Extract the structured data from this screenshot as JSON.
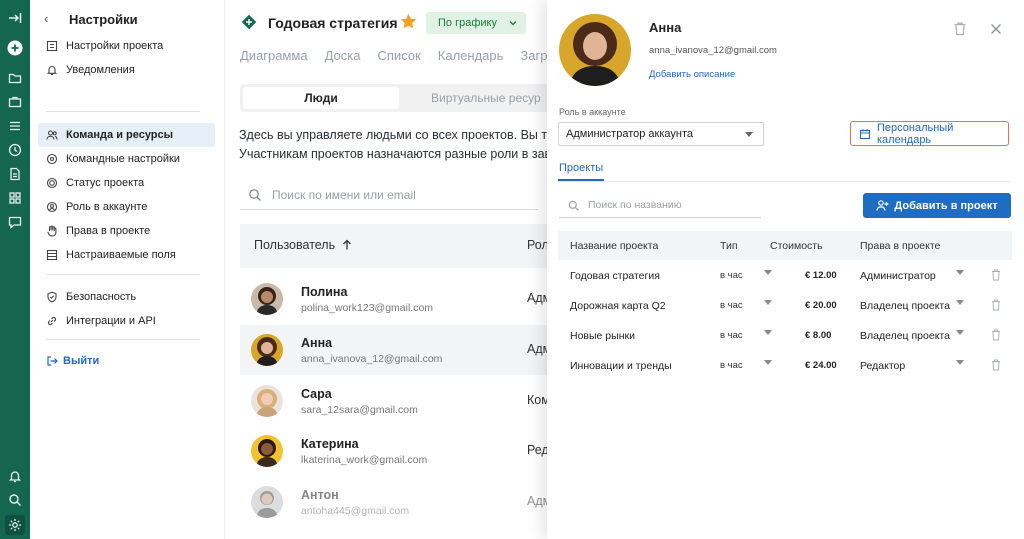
{
  "settings": {
    "title": "Настройки",
    "items": [
      {
        "label": "Настройки проекта",
        "icon": "project-settings-icon"
      },
      {
        "label": "Уведомления",
        "icon": "bell-icon"
      },
      {
        "label": "Команда и ресурсы",
        "icon": "team-icon",
        "active": true
      },
      {
        "label": "Командные настройки",
        "icon": "team-settings-icon"
      },
      {
        "label": "Статус проекта",
        "icon": "status-icon"
      },
      {
        "label": "Роль в аккаунте",
        "icon": "role-icon"
      },
      {
        "label": "Права в проекте",
        "icon": "hand-icon"
      },
      {
        "label": "Настраиваемые поля",
        "icon": "fields-icon"
      },
      {
        "label": "Безопасность",
        "icon": "shield-icon"
      },
      {
        "label": "Интеграции и API",
        "icon": "integrations-icon"
      }
    ],
    "logout": "Выйти"
  },
  "project": {
    "title": "Годовая стратегия",
    "status": "По графику",
    "views": [
      "Диаграмма",
      "Доска",
      "Список",
      "Календарь",
      "Загр"
    ],
    "segments": [
      "Люди",
      "Виртуальные ресур"
    ],
    "description_line1": "Здесь вы управляете людьми со всех проектов. Вы та",
    "description_line2": "Участникам проектов назначаются разные роли в зав",
    "search_placeholder": "Поиск по имени или email",
    "col_user": "Пользователь",
    "col_role": "Рол"
  },
  "users": [
    {
      "name": "Полина",
      "email": "polina_work123@gmail.com",
      "role": "Адм"
    },
    {
      "name": "Анна",
      "email": "anna_ivanova_12@gmail.com",
      "role": "Адм"
    },
    {
      "name": "Сара",
      "email": "sara_12sara@gmail.com",
      "role": "Ком"
    },
    {
      "name": "Катерина",
      "email": "lkaterina_work@gmail.com",
      "role": "Ред"
    },
    {
      "name": "Антон",
      "email": "antoha445@gmail.com",
      "role": "Адм"
    }
  ],
  "panel": {
    "name": "Анна",
    "email": "anna_ivanova_12@gmail.com",
    "add_description": "Добавить описание",
    "role_label": "Роль в аккаунте",
    "role_value": "Администратор аккаунта",
    "calendar_button": "Персональный календарь",
    "tab_projects": "Проекты",
    "search_placeholder": "Поиск по названию",
    "add_to_project": "Добавить в проект",
    "columns": [
      "Название проекта",
      "Тип",
      "Стоимость",
      "Права в проекте"
    ],
    "projects": [
      {
        "name": "Годовая стратегия",
        "type": "в час",
        "cost": "€ 12.00",
        "rights": "Администратор"
      },
      {
        "name": "Дорожная карта Q2",
        "type": "в час",
        "cost": "€ 20.00",
        "rights": "Владелец проекта"
      },
      {
        "name": "Новые рынки",
        "type": "в час",
        "cost": "€ 8.00",
        "rights": "Владелец проекта"
      },
      {
        "name": "Инновации и тренды",
        "type": "в час",
        "cost": "€ 24.00",
        "rights": "Редактор"
      }
    ]
  },
  "colors": {
    "rail": "#14664f",
    "accent": "#2368c4",
    "primary_button": "#1f6dc2",
    "status_bg": "#dff2e3",
    "star": "#f4a11c"
  }
}
